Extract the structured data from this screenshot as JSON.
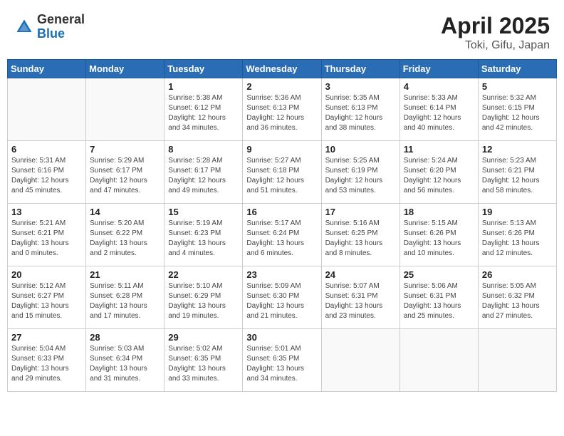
{
  "header": {
    "logo_line1": "General",
    "logo_line2": "Blue",
    "title": "April 2025",
    "location": "Toki, Gifu, Japan"
  },
  "days_of_week": [
    "Sunday",
    "Monday",
    "Tuesday",
    "Wednesday",
    "Thursday",
    "Friday",
    "Saturday"
  ],
  "weeks": [
    [
      {
        "day": "",
        "info": ""
      },
      {
        "day": "",
        "info": ""
      },
      {
        "day": "1",
        "info": "Sunrise: 5:38 AM\nSunset: 6:12 PM\nDaylight: 12 hours\nand 34 minutes."
      },
      {
        "day": "2",
        "info": "Sunrise: 5:36 AM\nSunset: 6:13 PM\nDaylight: 12 hours\nand 36 minutes."
      },
      {
        "day": "3",
        "info": "Sunrise: 5:35 AM\nSunset: 6:13 PM\nDaylight: 12 hours\nand 38 minutes."
      },
      {
        "day": "4",
        "info": "Sunrise: 5:33 AM\nSunset: 6:14 PM\nDaylight: 12 hours\nand 40 minutes."
      },
      {
        "day": "5",
        "info": "Sunrise: 5:32 AM\nSunset: 6:15 PM\nDaylight: 12 hours\nand 42 minutes."
      }
    ],
    [
      {
        "day": "6",
        "info": "Sunrise: 5:31 AM\nSunset: 6:16 PM\nDaylight: 12 hours\nand 45 minutes."
      },
      {
        "day": "7",
        "info": "Sunrise: 5:29 AM\nSunset: 6:17 PM\nDaylight: 12 hours\nand 47 minutes."
      },
      {
        "day": "8",
        "info": "Sunrise: 5:28 AM\nSunset: 6:17 PM\nDaylight: 12 hours\nand 49 minutes."
      },
      {
        "day": "9",
        "info": "Sunrise: 5:27 AM\nSunset: 6:18 PM\nDaylight: 12 hours\nand 51 minutes."
      },
      {
        "day": "10",
        "info": "Sunrise: 5:25 AM\nSunset: 6:19 PM\nDaylight: 12 hours\nand 53 minutes."
      },
      {
        "day": "11",
        "info": "Sunrise: 5:24 AM\nSunset: 6:20 PM\nDaylight: 12 hours\nand 56 minutes."
      },
      {
        "day": "12",
        "info": "Sunrise: 5:23 AM\nSunset: 6:21 PM\nDaylight: 12 hours\nand 58 minutes."
      }
    ],
    [
      {
        "day": "13",
        "info": "Sunrise: 5:21 AM\nSunset: 6:21 PM\nDaylight: 13 hours\nand 0 minutes."
      },
      {
        "day": "14",
        "info": "Sunrise: 5:20 AM\nSunset: 6:22 PM\nDaylight: 13 hours\nand 2 minutes."
      },
      {
        "day": "15",
        "info": "Sunrise: 5:19 AM\nSunset: 6:23 PM\nDaylight: 13 hours\nand 4 minutes."
      },
      {
        "day": "16",
        "info": "Sunrise: 5:17 AM\nSunset: 6:24 PM\nDaylight: 13 hours\nand 6 minutes."
      },
      {
        "day": "17",
        "info": "Sunrise: 5:16 AM\nSunset: 6:25 PM\nDaylight: 13 hours\nand 8 minutes."
      },
      {
        "day": "18",
        "info": "Sunrise: 5:15 AM\nSunset: 6:26 PM\nDaylight: 13 hours\nand 10 minutes."
      },
      {
        "day": "19",
        "info": "Sunrise: 5:13 AM\nSunset: 6:26 PM\nDaylight: 13 hours\nand 12 minutes."
      }
    ],
    [
      {
        "day": "20",
        "info": "Sunrise: 5:12 AM\nSunset: 6:27 PM\nDaylight: 13 hours\nand 15 minutes."
      },
      {
        "day": "21",
        "info": "Sunrise: 5:11 AM\nSunset: 6:28 PM\nDaylight: 13 hours\nand 17 minutes."
      },
      {
        "day": "22",
        "info": "Sunrise: 5:10 AM\nSunset: 6:29 PM\nDaylight: 13 hours\nand 19 minutes."
      },
      {
        "day": "23",
        "info": "Sunrise: 5:09 AM\nSunset: 6:30 PM\nDaylight: 13 hours\nand 21 minutes."
      },
      {
        "day": "24",
        "info": "Sunrise: 5:07 AM\nSunset: 6:31 PM\nDaylight: 13 hours\nand 23 minutes."
      },
      {
        "day": "25",
        "info": "Sunrise: 5:06 AM\nSunset: 6:31 PM\nDaylight: 13 hours\nand 25 minutes."
      },
      {
        "day": "26",
        "info": "Sunrise: 5:05 AM\nSunset: 6:32 PM\nDaylight: 13 hours\nand 27 minutes."
      }
    ],
    [
      {
        "day": "27",
        "info": "Sunrise: 5:04 AM\nSunset: 6:33 PM\nDaylight: 13 hours\nand 29 minutes."
      },
      {
        "day": "28",
        "info": "Sunrise: 5:03 AM\nSunset: 6:34 PM\nDaylight: 13 hours\nand 31 minutes."
      },
      {
        "day": "29",
        "info": "Sunrise: 5:02 AM\nSunset: 6:35 PM\nDaylight: 13 hours\nand 33 minutes."
      },
      {
        "day": "30",
        "info": "Sunrise: 5:01 AM\nSunset: 6:35 PM\nDaylight: 13 hours\nand 34 minutes."
      },
      {
        "day": "",
        "info": ""
      },
      {
        "day": "",
        "info": ""
      },
      {
        "day": "",
        "info": ""
      }
    ]
  ]
}
